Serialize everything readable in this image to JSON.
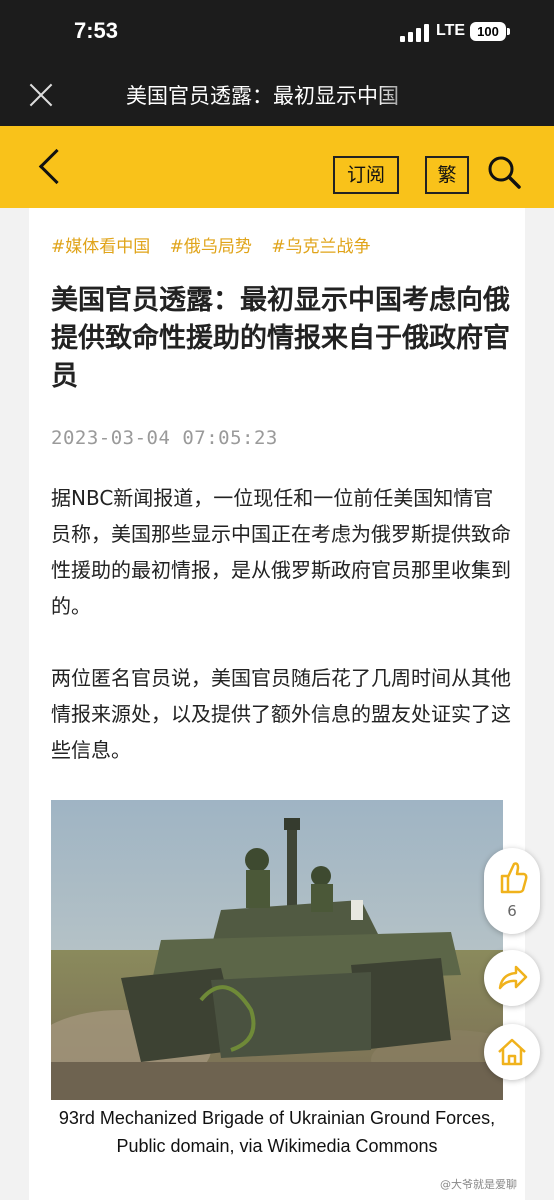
{
  "status_bar": {
    "time": "7:53",
    "network": "LTE",
    "battery": "100"
  },
  "window": {
    "title": "美国官员透露：最初显示中国"
  },
  "nav": {
    "subscribe_label": "订阅",
    "traditional_label": "繁"
  },
  "article": {
    "tags": [
      "#媒体看中国",
      "#俄乌局势",
      "#乌克兰战争"
    ],
    "headline": "美国官员透露：最初显示中国考虑向俄提供致命性援助的情报来自于俄政府官员",
    "date": "2023-03-04 07:05:23",
    "paragraphs": [
      "据NBC新闻报道，一位现任和一位前任美国知情官员称，美国那些显示中国正在考虑为俄罗斯提供致命性援助的最初情报，是从俄罗斯政府官员那里收集到的。",
      "两位匿名官员说，美国官员随后花了几周时间从其他情报来源处，以及提供了额外信息的盟友处证实了这些信息。"
    ],
    "image_caption": "93rd Mechanized Brigade of Ukrainian Ground Forces, Public domain, via Wikimedia Commons"
  },
  "actions": {
    "like_count": "6"
  },
  "watermark": "@大爷就是爱聊",
  "colors": {
    "accent": "#f9c21a",
    "tag": "#e0a41a",
    "action_icon": "#f0b21c"
  }
}
